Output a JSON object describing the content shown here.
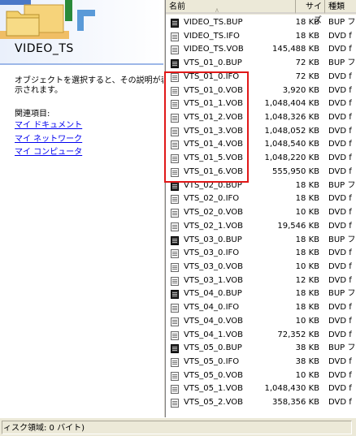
{
  "folder": {
    "title": "VIDEO_TS",
    "description_lines": [
      "オブジェクトを選択すると、その説明が表",
      "示されます。"
    ],
    "related_heading": "関連項目:",
    "related_links": [
      "マイ ドキュメント",
      "マイ ネットワーク",
      "マイ コンピュータ"
    ]
  },
  "columns": {
    "name": "名前",
    "size": "サイズ",
    "type": "種類"
  },
  "files": [
    {
      "name": "VIDEO_TS.BUP",
      "size": "18 KB",
      "type": "BUP フ",
      "icon": "bup-file-icon"
    },
    {
      "name": "VIDEO_TS.IFO",
      "size": "18 KB",
      "type": "DVD f",
      "icon": "ifo-file-icon"
    },
    {
      "name": "VIDEO_TS.VOB",
      "size": "145,488 KB",
      "type": "DVD f",
      "icon": "vob-file-icon"
    },
    {
      "name": "VTS_01_0.BUP",
      "size": "72 KB",
      "type": "BUP フ",
      "icon": "bup-file-icon"
    },
    {
      "name": "VTS_01_0.IFO",
      "size": "72 KB",
      "type": "DVD f",
      "icon": "ifo-file-icon"
    },
    {
      "name": "VTS_01_0.VOB",
      "size": "3,920 KB",
      "type": "DVD f",
      "icon": "vob-file-icon"
    },
    {
      "name": "VTS_01_1.VOB",
      "size": "1,048,404 KB",
      "type": "DVD f",
      "icon": "vob-file-icon"
    },
    {
      "name": "VTS_01_2.VOB",
      "size": "1,048,326 KB",
      "type": "DVD f",
      "icon": "vob-file-icon"
    },
    {
      "name": "VTS_01_3.VOB",
      "size": "1,048,052 KB",
      "type": "DVD f",
      "icon": "vob-file-icon"
    },
    {
      "name": "VTS_01_4.VOB",
      "size": "1,048,540 KB",
      "type": "DVD f",
      "icon": "vob-file-icon"
    },
    {
      "name": "VTS_01_5.VOB",
      "size": "1,048,220 KB",
      "type": "DVD f",
      "icon": "vob-file-icon"
    },
    {
      "name": "VTS_01_6.VOB",
      "size": "555,950 KB",
      "type": "DVD f",
      "icon": "vob-file-icon"
    },
    {
      "name": "VTS_02_0.BUP",
      "size": "18 KB",
      "type": "BUP フ",
      "icon": "bup-file-icon"
    },
    {
      "name": "VTS_02_0.IFO",
      "size": "18 KB",
      "type": "DVD f",
      "icon": "ifo-file-icon"
    },
    {
      "name": "VTS_02_0.VOB",
      "size": "10 KB",
      "type": "DVD f",
      "icon": "vob-file-icon"
    },
    {
      "name": "VTS_02_1.VOB",
      "size": "19,546 KB",
      "type": "DVD f",
      "icon": "vob-file-icon"
    },
    {
      "name": "VTS_03_0.BUP",
      "size": "18 KB",
      "type": "BUP フ",
      "icon": "bup-file-icon"
    },
    {
      "name": "VTS_03_0.IFO",
      "size": "18 KB",
      "type": "DVD f",
      "icon": "ifo-file-icon"
    },
    {
      "name": "VTS_03_0.VOB",
      "size": "10 KB",
      "type": "DVD f",
      "icon": "vob-file-icon"
    },
    {
      "name": "VTS_03_1.VOB",
      "size": "12 KB",
      "type": "DVD f",
      "icon": "vob-file-icon"
    },
    {
      "name": "VTS_04_0.BUP",
      "size": "18 KB",
      "type": "BUP フ",
      "icon": "bup-file-icon"
    },
    {
      "name": "VTS_04_0.IFO",
      "size": "18 KB",
      "type": "DVD f",
      "icon": "ifo-file-icon"
    },
    {
      "name": "VTS_04_0.VOB",
      "size": "10 KB",
      "type": "DVD f",
      "icon": "vob-file-icon"
    },
    {
      "name": "VTS_04_1.VOB",
      "size": "72,352 KB",
      "type": "DVD f",
      "icon": "vob-file-icon"
    },
    {
      "name": "VTS_05_0.BUP",
      "size": "38 KB",
      "type": "BUP フ",
      "icon": "bup-file-icon"
    },
    {
      "name": "VTS_05_0.IFO",
      "size": "38 KB",
      "type": "DVD f",
      "icon": "ifo-file-icon"
    },
    {
      "name": "VTS_05_0.VOB",
      "size": "10 KB",
      "type": "DVD f",
      "icon": "vob-file-icon"
    },
    {
      "name": "VTS_05_1.VOB",
      "size": "1,048,430 KB",
      "type": "DVD f",
      "icon": "vob-file-icon"
    },
    {
      "name": "VTS_05_2.VOB",
      "size": "358,356 KB",
      "type": "DVD f",
      "icon": "vob-file-icon"
    }
  ],
  "status_bar": {
    "text": "ィスク領域: 0 バイト)"
  },
  "colors": {
    "link": "#0000ee",
    "highlight_box": "#e01818",
    "header_bg": "#ece9d8"
  }
}
